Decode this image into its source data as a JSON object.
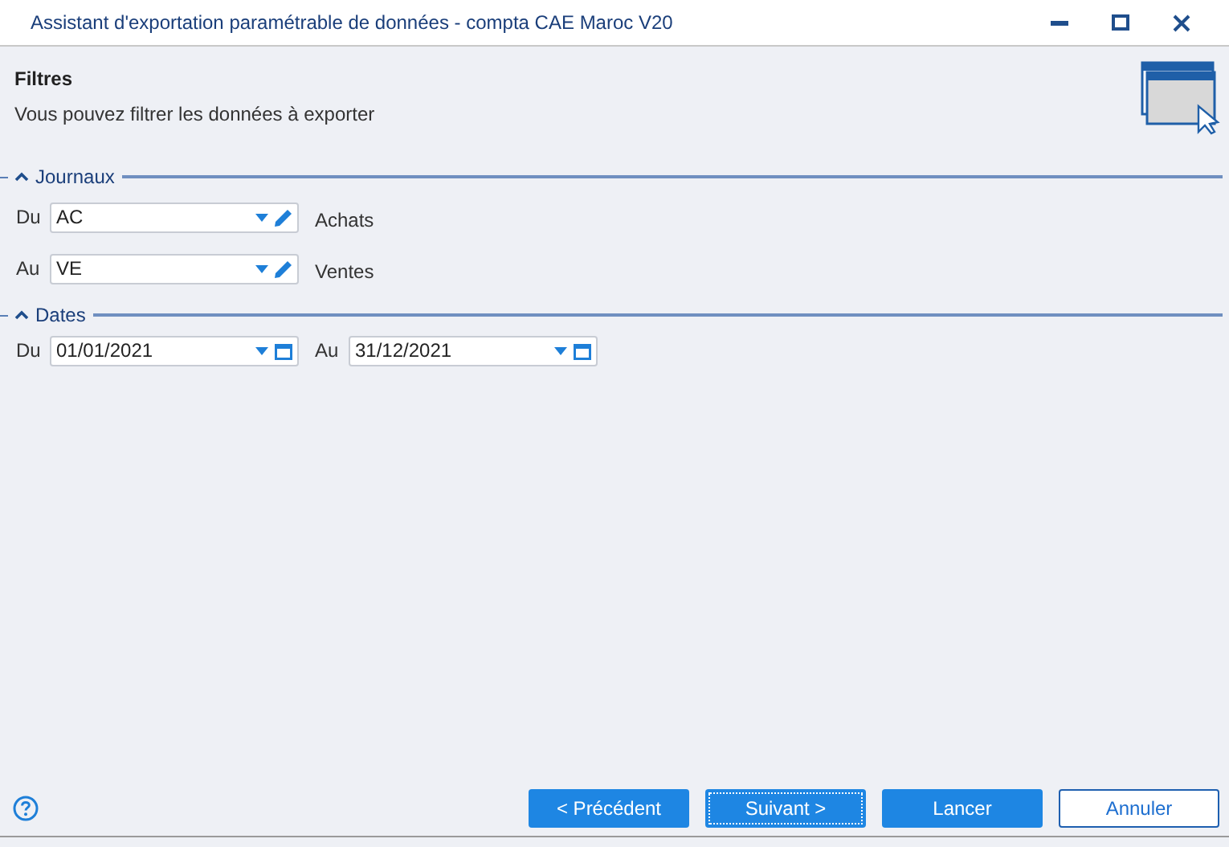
{
  "window": {
    "title": "Assistant d'exportation paramétrable de données - compta CAE Maroc V20"
  },
  "header": {
    "title": "Filtres",
    "subtitle": "Vous pouvez filtrer les données à exporter"
  },
  "sections": [
    {
      "title": "Journaux",
      "expanded": true,
      "rows": [
        {
          "kind": "journal",
          "label": "Du",
          "value": "AC",
          "description": "Achats"
        },
        {
          "kind": "journal",
          "label": "Au",
          "value": "VE",
          "description": "Ventes"
        }
      ]
    },
    {
      "title": "Dates",
      "expanded": true,
      "rows": [
        {
          "kind": "dates",
          "label": "Du",
          "value": "01/01/2021",
          "label2": "Au",
          "value2": "31/12/2021"
        }
      ]
    }
  ],
  "buttons": [
    {
      "label": "< Précédent",
      "kind": "primary",
      "focused": false
    },
    {
      "label": "Suivant >",
      "kind": "primary",
      "focused": true
    },
    {
      "label": "Lancer",
      "kind": "primary",
      "focused": false
    },
    {
      "label": "Annuler",
      "kind": "secondary",
      "focused": false
    }
  ]
}
